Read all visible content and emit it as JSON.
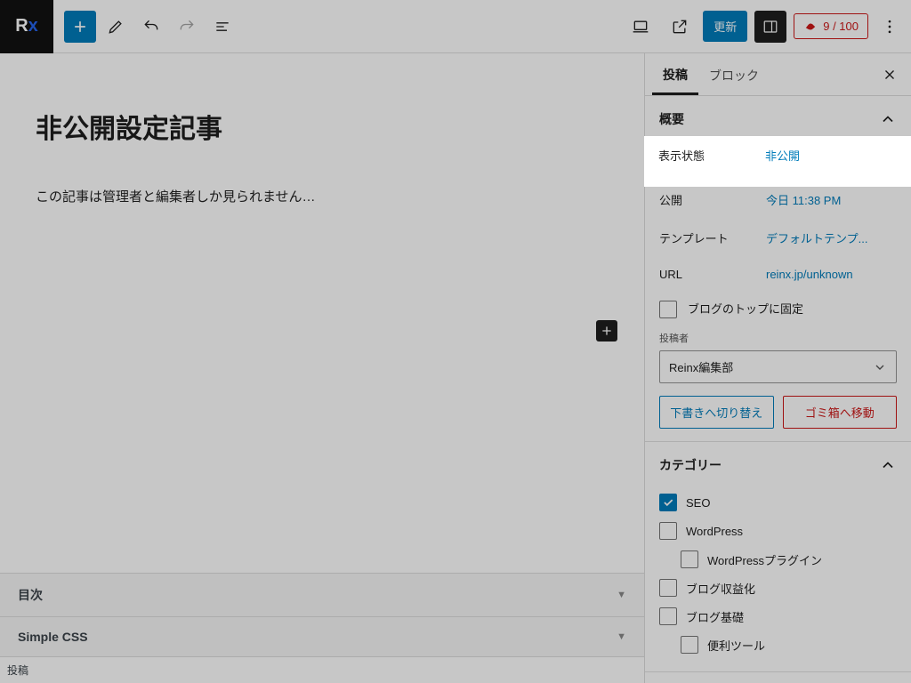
{
  "logo": {
    "r": "R",
    "x": "x"
  },
  "toolbar": {
    "update": "更新",
    "score": "9 / 100"
  },
  "editor": {
    "title": "非公開設定記事",
    "body": "この記事は管理者と編集者しか見られません…"
  },
  "bottom": {
    "toc": "目次",
    "simplecss": "Simple CSS",
    "footer": "投稿"
  },
  "sidebar": {
    "tabs": {
      "post": "投稿",
      "block": "ブロック"
    },
    "summary": {
      "title": "概要",
      "rows": {
        "visibility": {
          "k": "表示状態",
          "v": "非公開"
        },
        "publish": {
          "k": "公開",
          "v": "今日 11:38 PM"
        },
        "template": {
          "k": "テンプレート",
          "v": "デフォルトテンプ..."
        },
        "url": {
          "k": "URL",
          "v": "reinx.jp/unknown"
        }
      },
      "pin": "ブログのトップに固定",
      "author_label": "投稿者",
      "author_value": "Reinx編集部",
      "to_draft": "下書きへ切り替え",
      "to_trash": "ゴミ箱へ移動"
    },
    "categories": {
      "title": "カテゴリー",
      "items": [
        {
          "label": "SEO",
          "checked": true,
          "indent": false
        },
        {
          "label": "WordPress",
          "checked": false,
          "indent": false
        },
        {
          "label": "WordPressプラグイン",
          "checked": false,
          "indent": true
        },
        {
          "label": "ブログ収益化",
          "checked": false,
          "indent": false
        },
        {
          "label": "ブログ基礎",
          "checked": false,
          "indent": false
        },
        {
          "label": "便利ツール",
          "checked": false,
          "indent": true
        }
      ]
    }
  }
}
